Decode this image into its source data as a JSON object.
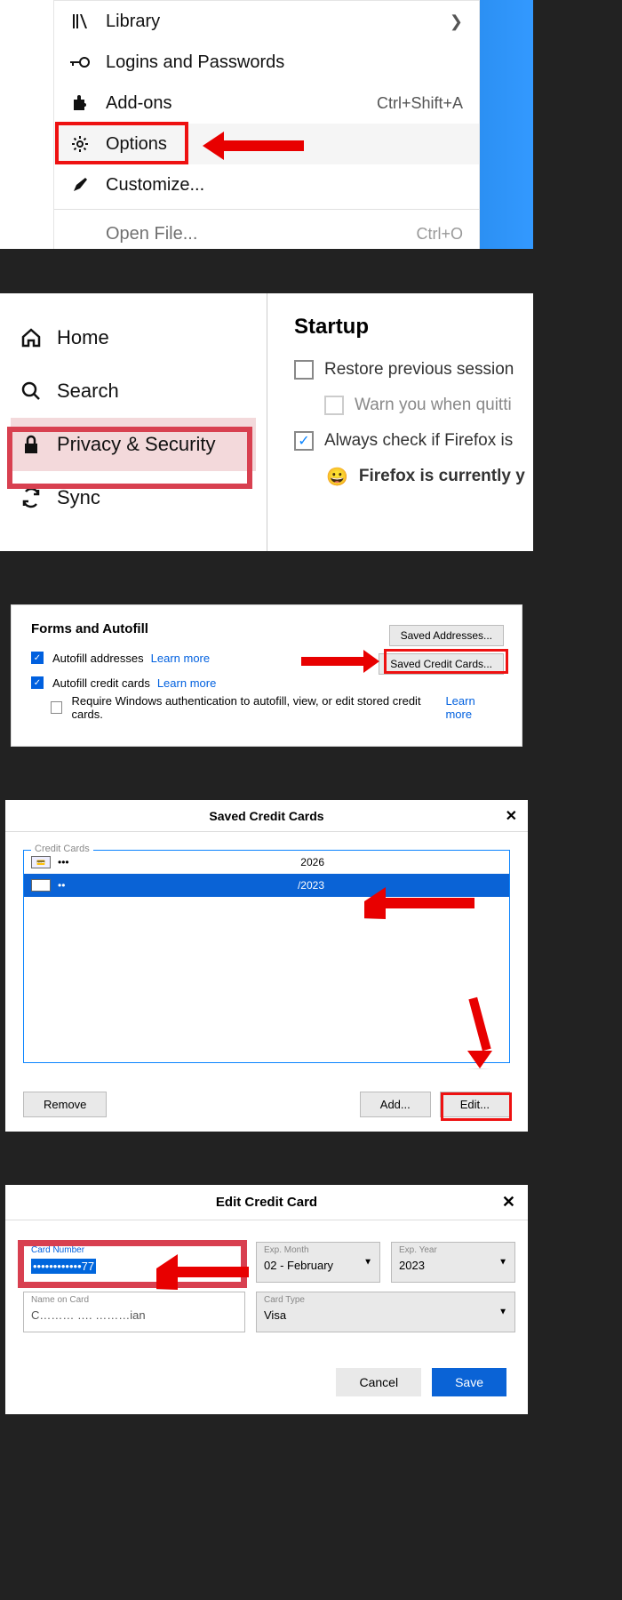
{
  "panel1": {
    "library": "Library",
    "logins": "Logins and Passwords",
    "addons": "Add-ons",
    "addons_shortcut": "Ctrl+Shift+A",
    "options": "Options",
    "customize": "Customize...",
    "openfile": "Open File...",
    "openfile_shortcut": "Ctrl+O"
  },
  "panel2": {
    "home": "Home",
    "search": "Search",
    "privacy": "Privacy & Security",
    "sync": "Sync",
    "startup": "Startup",
    "restore": "Restore previous session",
    "warn": "Warn you when quitti",
    "always": "Always check if Firefox is",
    "default": "Firefox is currently y"
  },
  "panel3": {
    "title": "Forms and Autofill",
    "addr": "Autofill addresses",
    "cc": "Autofill credit cards",
    "learn": "Learn more",
    "winauth": "Require Windows authentication to autofill, view, or edit stored credit cards.",
    "btn_addr": "Saved Addresses...",
    "btn_cc": "Saved Credit Cards..."
  },
  "panel4": {
    "title": "Saved Credit Cards",
    "boxlabel": "Credit Cards",
    "card1_mask": "•••",
    "card1_exp": "2026",
    "card2_mask": "••",
    "card2_exp": "/2023",
    "remove": "Remove",
    "add": "Add...",
    "edit": "Edit..."
  },
  "panel5": {
    "title": "Edit Credit Card",
    "cardnum_label": "Card Number",
    "cardnum_val": "••••••••••••77",
    "month_label": "Exp. Month",
    "month_val": "02 - February",
    "year_label": "Exp. Year",
    "year_val": "2023",
    "name_label": "Name on Card",
    "name_val": "C……… …. ………ian",
    "type_label": "Card Type",
    "type_val": "Visa",
    "cancel": "Cancel",
    "save": "Save"
  }
}
